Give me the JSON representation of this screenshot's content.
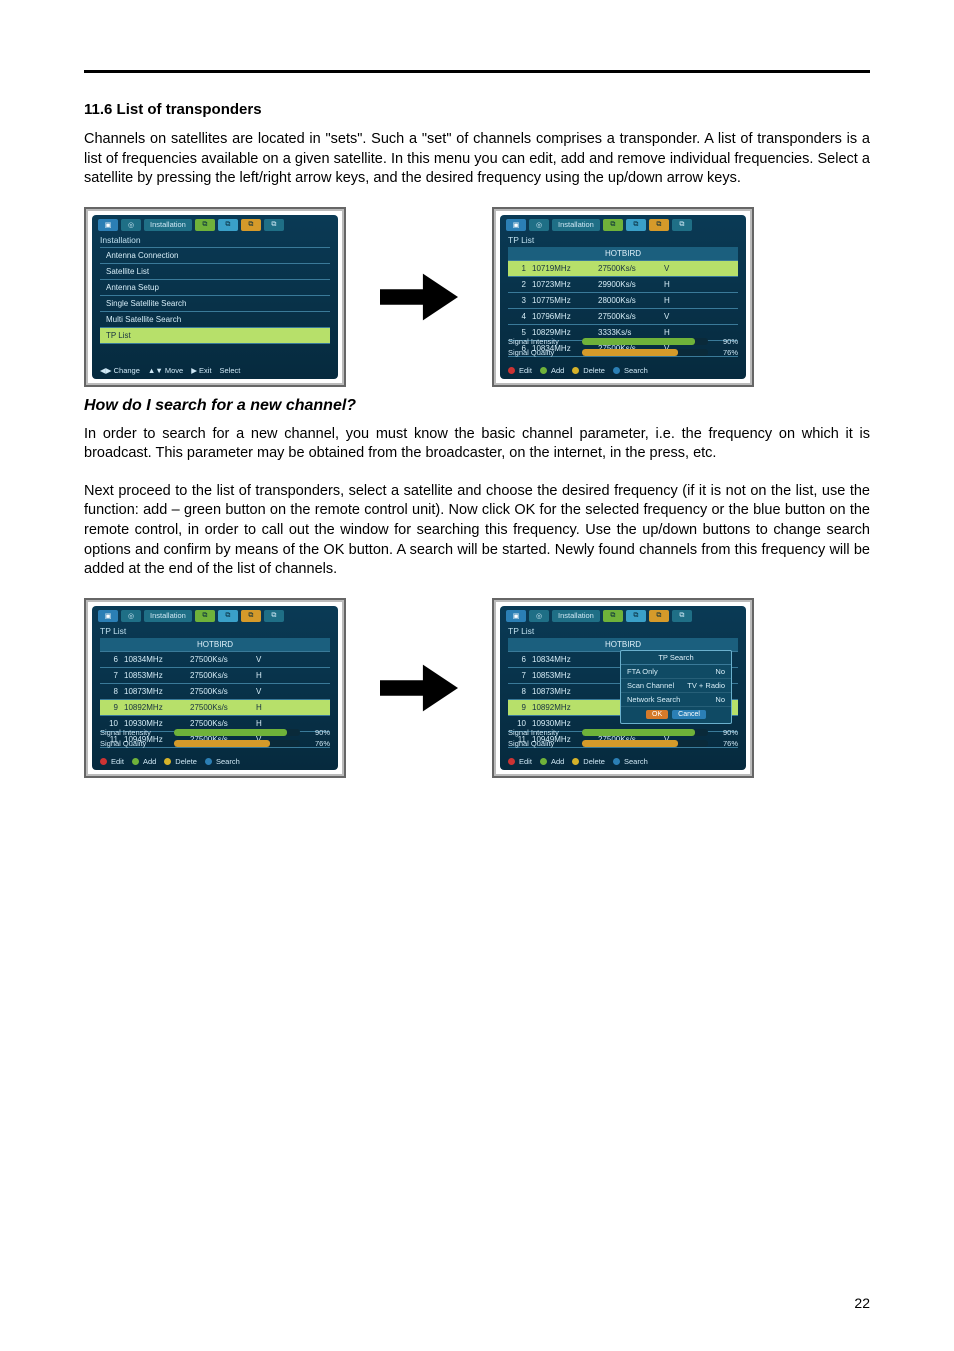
{
  "page_number": "22",
  "section_title": "11.6 List of transponders",
  "paragraphs": {
    "p1": "Channels on satellites are located in \"sets\". Such a \"set\" of channels comprises a transponder. A list of transponders is a list of frequencies available on a given satellite. In this menu you can edit, add and remove individual frequencies. Select a satellite by pressing the left/right arrow keys, and the desired frequency using the up/down arrow keys.",
    "subheading": "How do I search for a new channel?",
    "p2": "In order to search for a new channel, you must know the basic channel parameter, i.e. the frequency on which it is broadcast. This parameter may be obtained from the broadcaster, on the internet, in the press, etc.",
    "p3": "Next proceed to the list of transponders, select a satellite and choose the desired frequency (if it is not on the list, use the function: add – green button on the remote control unit). Now click OK for the selected frequency or the blue button on the remote control, in order to call out the window for searching this frequency. Use the up/down buttons to change search options and confirm by means of the OK button. A search will be started. Newly found channels from this frequency will be added at the end of the list of channels."
  },
  "screens": {
    "installation_menu": {
      "topbar_label": "Installation",
      "section": "Installation",
      "items": [
        "Antenna Connection",
        "Satellite List",
        "Antenna Setup",
        "Single Satellite Search",
        "Multi Satellite Search",
        "TP List"
      ],
      "selected_index": 5,
      "footer": [
        {
          "key": "◀▶ Change"
        },
        {
          "key": "▲▼ Move"
        },
        {
          "key": "▶ Exit"
        },
        {
          "key": "Select"
        }
      ]
    },
    "tp_list_a": {
      "topbar_label": "Installation",
      "title": "TP List",
      "sat_name": "HOTBIRD",
      "rows": [
        {
          "idx": "1",
          "freq": "10719MHz",
          "rate": "27500Ks/s",
          "pol": "V",
          "selected": true
        },
        {
          "idx": "2",
          "freq": "10723MHz",
          "rate": "29900Ks/s",
          "pol": "H"
        },
        {
          "idx": "3",
          "freq": "10775MHz",
          "rate": "28000Ks/s",
          "pol": "H"
        },
        {
          "idx": "4",
          "freq": "10796MHz",
          "rate": "27500Ks/s",
          "pol": "V"
        },
        {
          "idx": "5",
          "freq": "10829MHz",
          "rate": "3333Ks/s",
          "pol": "H"
        },
        {
          "idx": "6",
          "freq": "10834MHz",
          "rate": "27500Ks/s",
          "pol": "V"
        }
      ],
      "signal": {
        "intensity_label": "Signal Intensity",
        "intensity_pct": "90%",
        "quality_label": "Signal Quality",
        "quality_pct": "76%"
      },
      "footer": [
        {
          "dot": "red",
          "label": "Edit"
        },
        {
          "dot": "green",
          "label": "Add"
        },
        {
          "dot": "yellow",
          "label": "Delete"
        },
        {
          "dot": "blue",
          "label": "Search"
        }
      ]
    },
    "tp_list_b": {
      "topbar_label": "Installation",
      "title": "TP List",
      "sat_name": "HOTBIRD",
      "rows": [
        {
          "idx": "6",
          "freq": "10834MHz",
          "rate": "27500Ks/s",
          "pol": "V"
        },
        {
          "idx": "7",
          "freq": "10853MHz",
          "rate": "27500Ks/s",
          "pol": "H"
        },
        {
          "idx": "8",
          "freq": "10873MHz",
          "rate": "27500Ks/s",
          "pol": "V"
        },
        {
          "idx": "9",
          "freq": "10892MHz",
          "rate": "27500Ks/s",
          "pol": "H",
          "selected": true
        },
        {
          "idx": "10",
          "freq": "10930MHz",
          "rate": "27500Ks/s",
          "pol": "H"
        },
        {
          "idx": "11",
          "freq": "10949MHz",
          "rate": "27500Ks/s",
          "pol": "V"
        }
      ],
      "signal": {
        "intensity_label": "Signal Intensity",
        "intensity_pct": "90%",
        "quality_label": "Signal Quality",
        "quality_pct": "76%"
      },
      "footer": [
        {
          "dot": "red",
          "label": "Edit"
        },
        {
          "dot": "green",
          "label": "Add"
        },
        {
          "dot": "yellow",
          "label": "Delete"
        },
        {
          "dot": "blue",
          "label": "Search"
        }
      ]
    },
    "tp_search_popup": {
      "topbar_label": "Installation",
      "title": "TP List",
      "sat_name": "HOTBIRD",
      "rows": [
        {
          "idx": "6",
          "freq": "10834MHz"
        },
        {
          "idx": "7",
          "freq": "10853MHz"
        },
        {
          "idx": "8",
          "freq": "10873MHz"
        },
        {
          "idx": "9",
          "freq": "10892MHz",
          "selected": true
        },
        {
          "idx": "10",
          "freq": "10930MHz"
        },
        {
          "idx": "11",
          "freq": "10949MHz",
          "rate": "27500Ks/s",
          "pol": "V"
        }
      ],
      "popup": {
        "title": "TP Search",
        "rows": [
          {
            "label": "FTA Only",
            "value": "No"
          },
          {
            "label": "Scan Channel",
            "value": "TV + Radio"
          },
          {
            "label": "Network Search",
            "value": "No"
          }
        ],
        "ok": "OK",
        "cancel": "Cancel"
      },
      "signal": {
        "intensity_label": "Signal Intensity",
        "intensity_pct": "90%",
        "quality_label": "Signal Quality",
        "quality_pct": "76%"
      },
      "footer": [
        {
          "dot": "red",
          "label": "Edit"
        },
        {
          "dot": "green",
          "label": "Add"
        },
        {
          "dot": "yellow",
          "label": "Delete"
        },
        {
          "dot": "blue",
          "label": "Search"
        }
      ]
    }
  }
}
